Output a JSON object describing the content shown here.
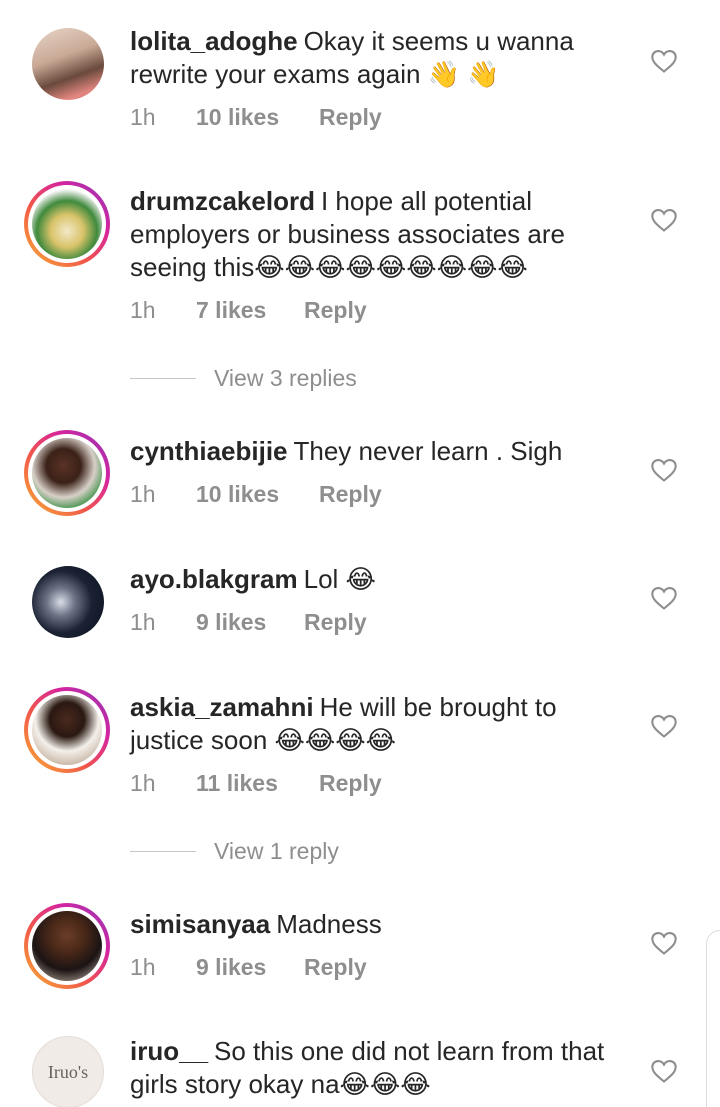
{
  "comments": [
    {
      "username": "lolita_adoghe",
      "text": "Okay it seems u wanna rewrite your exams again 👋 👋",
      "time": "1h",
      "likes": "10 likes",
      "reply": "Reply"
    },
    {
      "username": "drumzcakelord",
      "text": "I hope all potential employers or business associates are seeing this😂😂😂😂😂😂😂😂😂",
      "time": "1h",
      "likes": "7 likes",
      "reply": "Reply"
    },
    {
      "username": "cynthiaebijie",
      "text": "They never learn . Sigh",
      "time": "1h",
      "likes": "10 likes",
      "reply": "Reply"
    },
    {
      "username": "ayo.blakgram",
      "text": "Lol 😂",
      "time": "1h",
      "likes": "9 likes",
      "reply": "Reply"
    },
    {
      "username": "askia_zamahni",
      "text": "He will be brought to justice soon 😂😂😂😂",
      "time": "1h",
      "likes": "11 likes",
      "reply": "Reply"
    },
    {
      "username": "simisanyaa",
      "text": "Madness",
      "time": "1h",
      "likes": "9 likes",
      "reply": "Reply"
    },
    {
      "username": "iruo__",
      "text": "So this one did not learn from that girls story okay na😂😂😂",
      "avatar_text": "Iruo's"
    }
  ],
  "view_replies": [
    "View 3 replies",
    "View 1 reply"
  ],
  "colors": {
    "muted": "#8e8e8e",
    "text": "#262626",
    "story_gradient": [
      "#f9b233",
      "#f0554b",
      "#d6249f",
      "#8a3ab9"
    ]
  },
  "icons": {
    "like": "heart-outline-icon"
  }
}
